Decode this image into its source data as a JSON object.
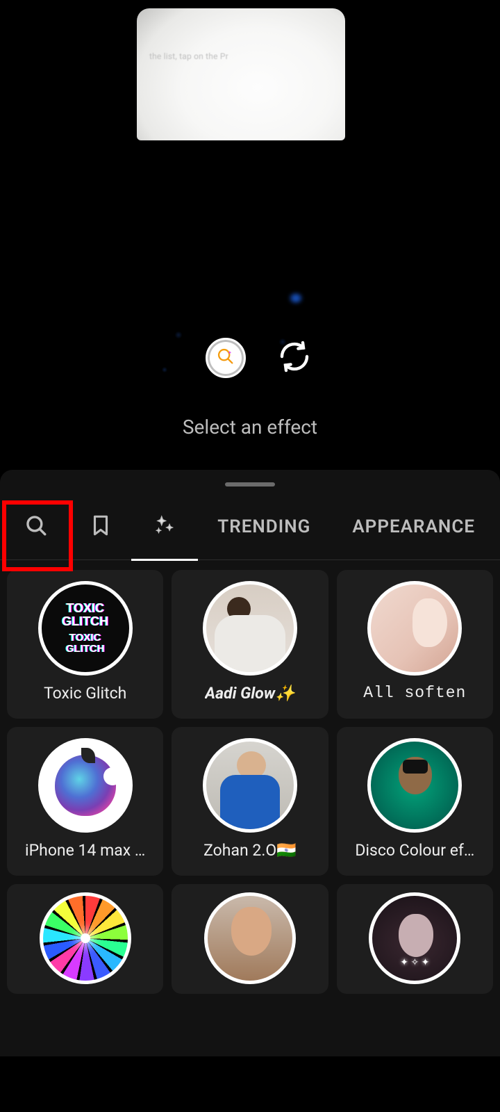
{
  "camera": {
    "faint_text": "the list, tap on the Pr",
    "prompt": "Select an effect"
  },
  "tabs": {
    "trending": "TRENDING",
    "appearance": "APPEARANCE"
  },
  "effects": [
    {
      "label": "Toxic Glitch",
      "thumb_text_1": "TOXIC",
      "thumb_text_2": "GLITCH",
      "thumb_text_3": "TOXIC",
      "thumb_text_4": "GLITCH"
    },
    {
      "label": "Aadi Glow✨"
    },
    {
      "label": "All soften"
    },
    {
      "label": "iPhone 14 max …"
    },
    {
      "label": "Zohan 2.O🇮🇳"
    },
    {
      "label": "Disco Colour ef…"
    },
    {
      "label": ""
    },
    {
      "label": ""
    },
    {
      "label": ""
    }
  ]
}
